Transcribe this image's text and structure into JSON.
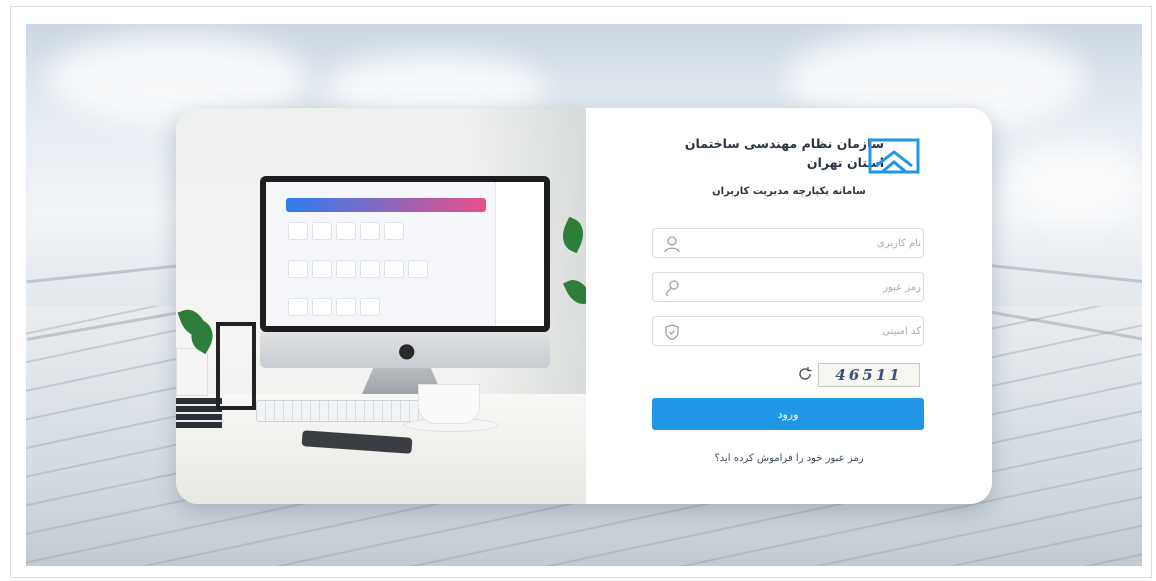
{
  "brand": {
    "org_name_line1": "سازمان نظام مهندسی ساختمان",
    "org_name_line2": "استان تهران",
    "system_name": "سامانه یکپارچه مدیریت کاربران",
    "logo_icon": "building-roof-logo-icon",
    "accent_color": "#1f96e6"
  },
  "form": {
    "username": {
      "placeholder": "نام کاربری",
      "value": "",
      "icon": "user-icon"
    },
    "password": {
      "placeholder": "رمز عبور",
      "value": "",
      "icon": "key-icon"
    },
    "security_code": {
      "placeholder": "کد امنیتی",
      "value": "",
      "icon": "shield-icon"
    },
    "captcha": {
      "text": "46511",
      "refresh_icon": "refresh-icon"
    },
    "login_label": "ورود",
    "forgot_label": "رمز عبور خود را فراموش کرده اید؟"
  }
}
